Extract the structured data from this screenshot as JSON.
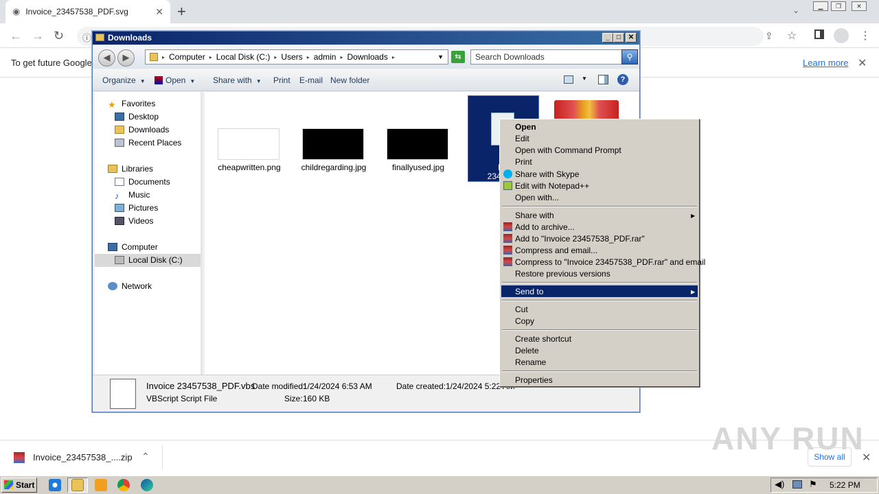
{
  "browser": {
    "tab_title": "Invoice_23457538_PDF.svg",
    "tab_close": "✕",
    "new_tab": "+",
    "infobar_text": "To get future Google",
    "learn_more": "Learn more",
    "info_close": "✕"
  },
  "explorer": {
    "title": "Downloads",
    "breadcrumb": [
      "Computer",
      "Local Disk (C:)",
      "Users",
      "admin",
      "Downloads"
    ],
    "search_placeholder": "Search Downloads",
    "commands": {
      "organize": "Organize",
      "open": "Open",
      "share_with": "Share with",
      "print": "Print",
      "email": "E-mail",
      "new_folder": "New folder"
    },
    "nav": {
      "favorites": "Favorites",
      "desktop": "Desktop",
      "downloads": "Downloads",
      "recent_places": "Recent Places",
      "libraries": "Libraries",
      "documents": "Documents",
      "music": "Music",
      "pictures": "Pictures",
      "videos": "Videos",
      "computer": "Computer",
      "local_disk": "Local Disk (C:)",
      "network": "Network"
    },
    "files": [
      {
        "name": "cheapwritten.png"
      },
      {
        "name": "childregarding.jpg"
      },
      {
        "name": "finallyused.jpg"
      }
    ],
    "selected_file_label_line1": "Inv",
    "selected_file_label_line2": "2345753",
    "status": {
      "file_name": "Invoice 23457538_PDF.vbs",
      "file_type": "VBScript Script File",
      "date_modified_label": "Date modified:",
      "date_modified": "1/24/2024 6:53 AM",
      "date_created_label": "Date created:",
      "date_created": "1/24/2024 5:22 AM",
      "size_label": "Size:",
      "size": "160 KB"
    }
  },
  "context_menu": {
    "open": "Open",
    "edit": "Edit",
    "open_cmd": "Open with Command Prompt",
    "print": "Print",
    "share_skype": "Share with Skype",
    "edit_notepad": "Edit with Notepad++",
    "open_with": "Open with...",
    "share_with": "Share with",
    "add_archive": "Add to archive...",
    "add_rar": "Add to \"Invoice 23457538_PDF.rar\"",
    "compress_email": "Compress and email...",
    "compress_rar_email": "Compress to \"Invoice 23457538_PDF.rar\" and email",
    "restore": "Restore previous versions",
    "send_to": "Send to",
    "cut": "Cut",
    "copy": "Copy",
    "create_shortcut": "Create shortcut",
    "delete": "Delete",
    "rename": "Rename",
    "properties": "Properties"
  },
  "downloads_bar": {
    "file": "Invoice_23457538_....zip",
    "show_all": "Show all"
  },
  "taskbar": {
    "start": "Start",
    "clock": "5:22 PM"
  },
  "watermark": "ANY RUN"
}
